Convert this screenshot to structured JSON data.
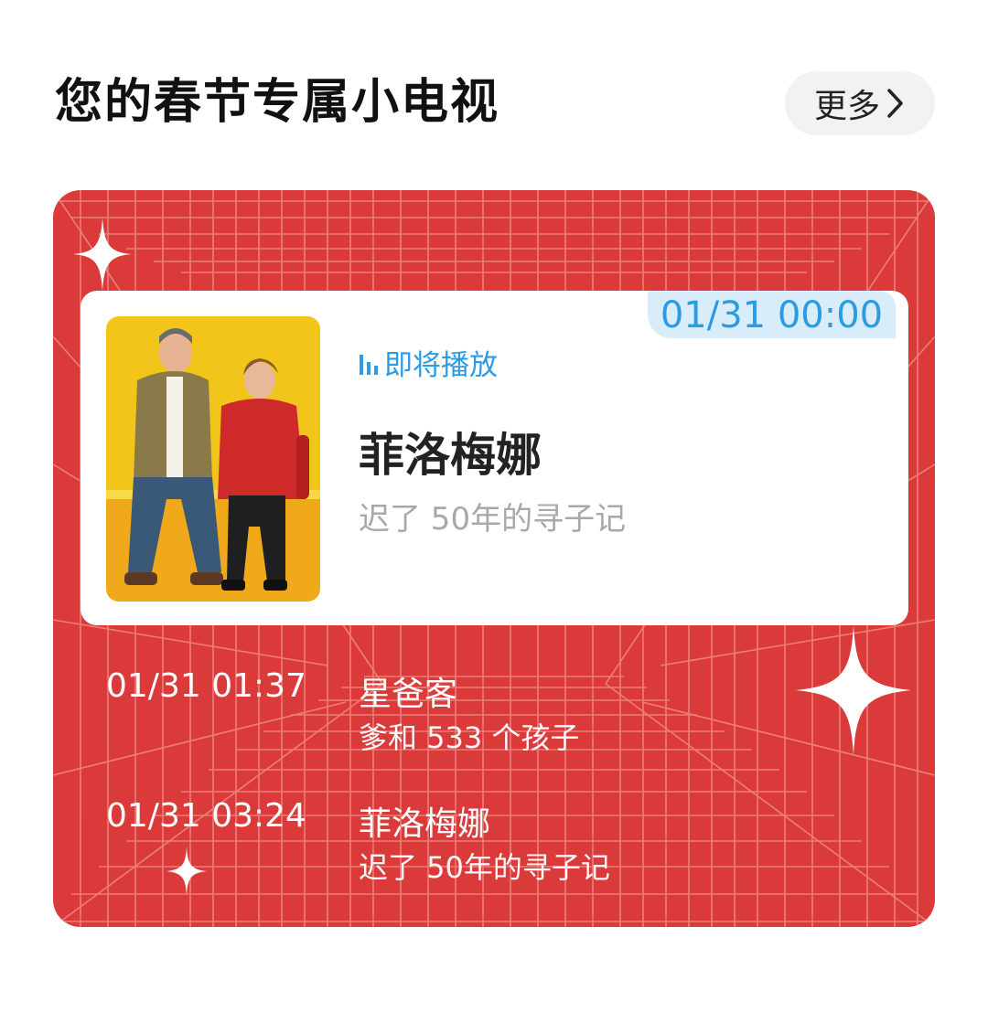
{
  "header": {
    "title": "您的春节专属小电视",
    "more_label": "更多"
  },
  "now_playing": {
    "time": "01/31 00:00",
    "status": "即将播放",
    "title": "菲洛梅娜",
    "subtitle": "迟了 50年的寻子记"
  },
  "schedule": [
    {
      "time": "01/31 01:37",
      "title": "星爸客",
      "subtitle": "爹和 533 个孩子"
    },
    {
      "time": "01/31 03:24",
      "title": "菲洛梅娜",
      "subtitle": "迟了 50年的寻子记"
    }
  ],
  "colors": {
    "card_red": "#db3a3a",
    "accent_blue": "#2a9be5",
    "badge_bg": "#d9ecf9"
  },
  "icons": [
    "chevron-right-icon",
    "sound-bars-icon",
    "sparkle-icon"
  ]
}
